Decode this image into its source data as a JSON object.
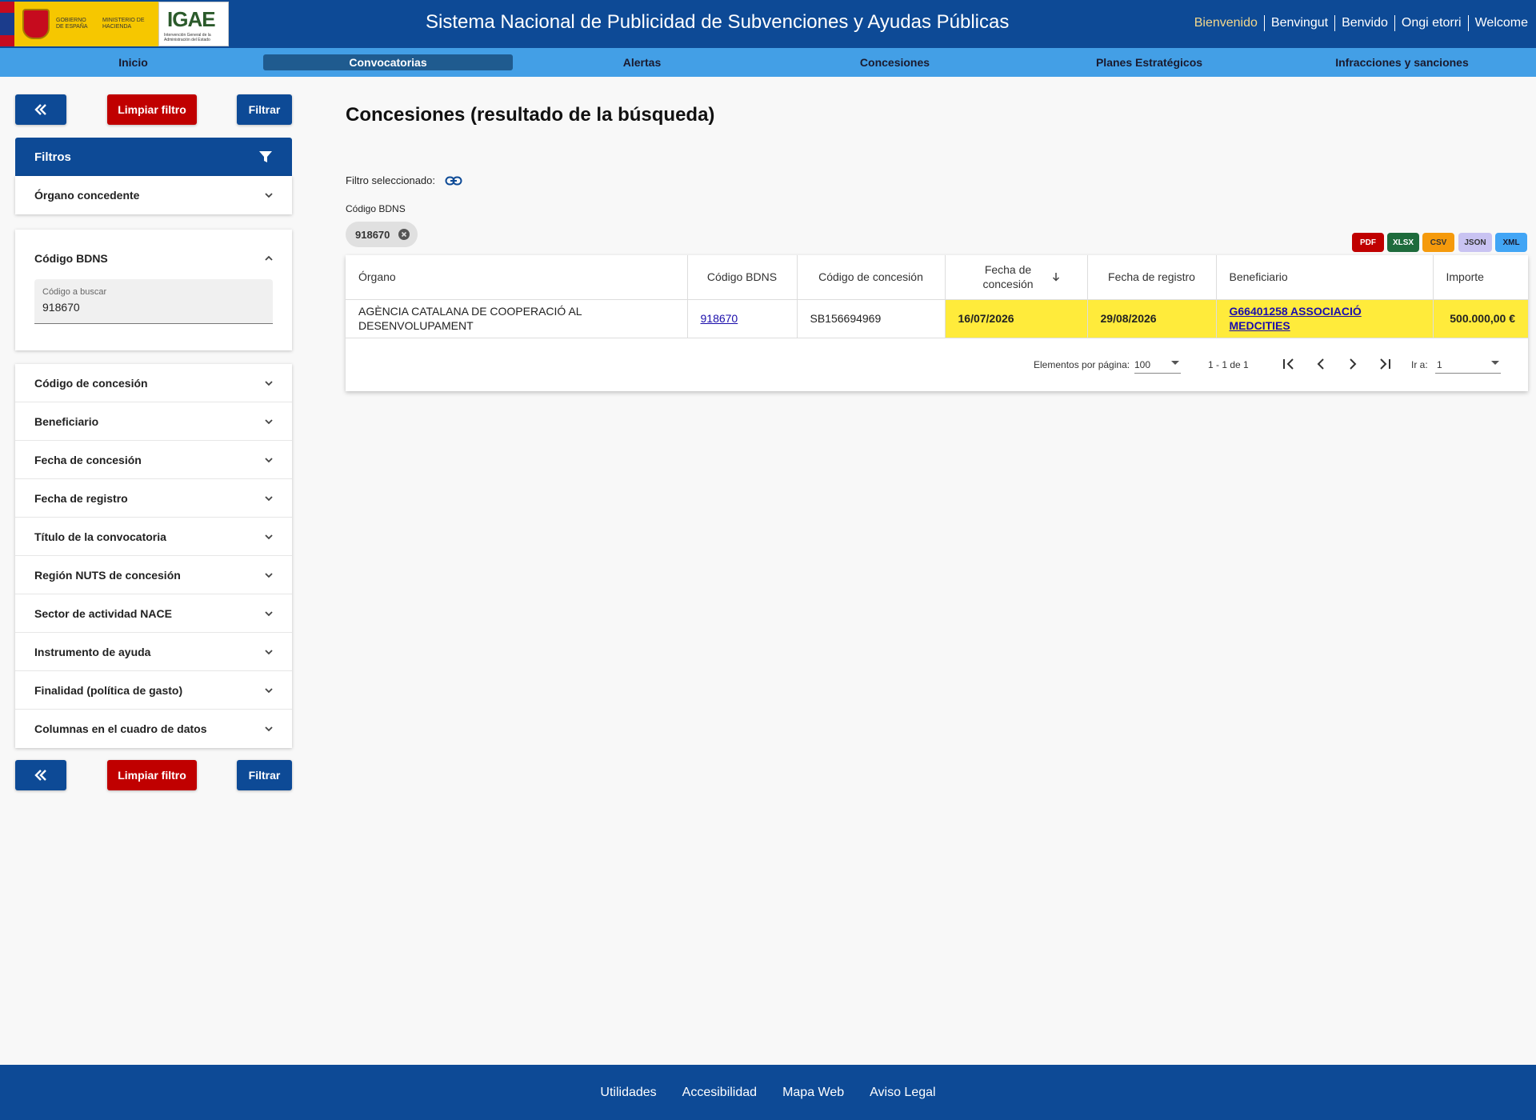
{
  "header": {
    "gov_text": "GOBIERNO DE ESPAÑA",
    "ministry_text": "MINISTERIO DE HACIENDA",
    "igae_mark": "IGAE",
    "igae_text": "Intervención General de la Administración del Estado",
    "title": "Sistema Nacional de Publicidad de Subvenciones y Ayudas Públicas",
    "languages": [
      "Bienvenido",
      "Benvingut",
      "Benvido",
      "Ongi etorri",
      "Welcome"
    ]
  },
  "nav": {
    "items": [
      "Inicio",
      "Convocatorias",
      "Alertas",
      "Concesiones",
      "Planes Estratégicos",
      "Infracciones y sanciones"
    ],
    "active": "Convocatorias"
  },
  "sidebar": {
    "back_icon": "double-chevron-left-icon",
    "clear_label": "Limpiar filtro",
    "filter_label": "Filtrar",
    "filters_title": "Filtros",
    "organo": "Órgano concedente",
    "bdns_title": "Código BDNS",
    "bdns_field_label": "Código a buscar",
    "bdns_field_value": "918670",
    "filters": [
      "Código de concesión",
      "Beneficiario",
      "Fecha de concesión",
      "Fecha de registro",
      "Título de la convocatoria",
      "Región NUTS de concesión",
      "Sector de actividad NACE",
      "Instrumento de ayuda",
      "Finalidad (política de gasto)",
      "Columnas en el cuadro de datos"
    ]
  },
  "main": {
    "title": "Concesiones (resultado de la búsqueda)",
    "selected_filter_label": "Filtro seleccionado:",
    "chip_label": "Código BDNS",
    "chip_value": "918670",
    "exports": [
      {
        "label": "PDF",
        "bg": "#c00000",
        "fg": "#ffffff"
      },
      {
        "label": "XLSX",
        "bg": "#1e6b3c",
        "fg": "#ffffff"
      },
      {
        "label": "CSV",
        "bg": "#f59a0c",
        "fg": "#333333"
      },
      {
        "label": "JSON",
        "bg": "#c9c3f2",
        "fg": "#333333"
      },
      {
        "label": "XML",
        "bg": "#42a5f5",
        "fg": "#1a1a2e"
      }
    ]
  },
  "table": {
    "headers": [
      "Órgano",
      "Código BDNS",
      "Código de concesión",
      "Fecha de concesión",
      "Fecha de registro",
      "Beneficiario",
      "Importe"
    ],
    "rows": [
      {
        "organo": "AGÈNCIA CATALANA DE COOPERACIÓ AL DESENVOLUPAMENT",
        "bdns": "918670",
        "concesion": "SB156694969",
        "fecha_concesion": "16/07/2026",
        "fecha_registro": "29/08/2026",
        "beneficiario": "G66401258 ASSOCIACIÓ MEDCITIES",
        "importe": "500.000,00 €"
      }
    ]
  },
  "paginator": {
    "items_label": "Elementos por página:",
    "items_value": "100",
    "range": "1 - 1 de 1",
    "goto_label": "Ir a:",
    "goto_value": "1"
  },
  "footer": {
    "links": [
      "Utilidades",
      "Accesibilidad",
      "Mapa Web",
      "Aviso Legal"
    ]
  },
  "colors": {
    "primary": "#0d4a96",
    "nav": "#439fe6",
    "danger": "#c00000",
    "highlight": "#ffeb3b"
  }
}
